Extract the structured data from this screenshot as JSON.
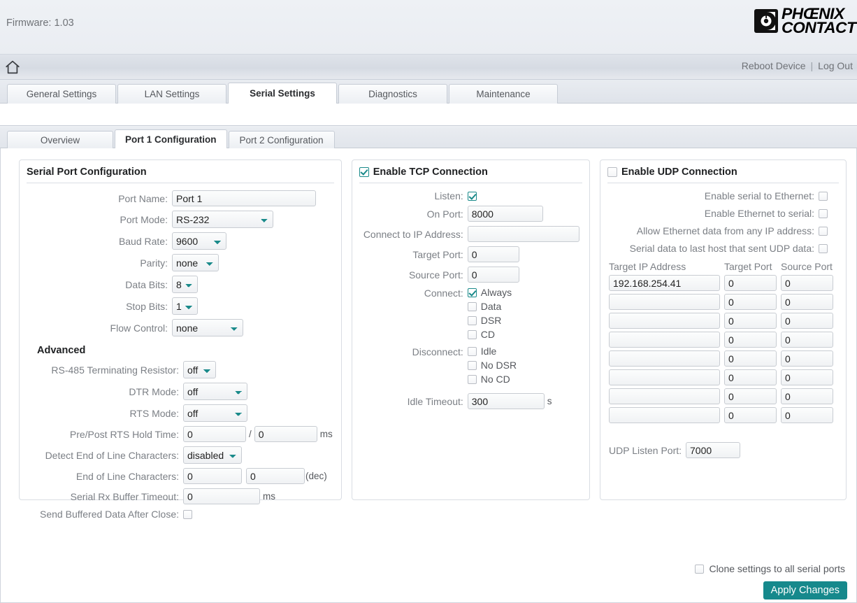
{
  "header": {
    "firmware": "Firmware: 1.03",
    "logo_line1": "PHŒNIX",
    "logo_line2": "CONTACT"
  },
  "nav": {
    "reboot": "Reboot Device",
    "separator": "|",
    "logout": "Log Out"
  },
  "tabs_primary": [
    {
      "label": "General Settings",
      "active": false
    },
    {
      "label": "LAN Settings",
      "active": false
    },
    {
      "label": "Serial Settings",
      "active": true
    },
    {
      "label": "Diagnostics",
      "active": false
    },
    {
      "label": "Maintenance",
      "active": false
    }
  ],
  "tabs_secondary": [
    {
      "label": "Overview",
      "active": false
    },
    {
      "label": "Port 1 Configuration",
      "active": true
    },
    {
      "label": "Port 2 Configuration",
      "active": false
    }
  ],
  "serial": {
    "title": "Serial Port Configuration",
    "advanced_title": "Advanced",
    "port_name_label": "Port Name:",
    "port_name_value": "Port 1",
    "port_mode_label": "Port Mode:",
    "port_mode_value": "RS-232",
    "baud_rate_label": "Baud Rate:",
    "baud_rate_value": "9600",
    "parity_label": "Parity:",
    "parity_value": "none",
    "data_bits_label": "Data Bits:",
    "data_bits_value": "8",
    "stop_bits_label": "Stop Bits:",
    "stop_bits_value": "1",
    "flow_control_label": "Flow Control:",
    "flow_control_value": "none",
    "rs485_label": "RS-485 Terminating Resistor:",
    "rs485_value": "off",
    "dtr_label": "DTR Mode:",
    "dtr_value": "off",
    "rts_label": "RTS Mode:",
    "rts_value": "off",
    "rts_hold_label": "Pre/Post RTS Hold Time:",
    "rts_hold_pre": "0",
    "rts_hold_sep": "/",
    "rts_hold_post": "0",
    "rts_hold_unit": "ms",
    "detect_eol_label": "Detect End of Line Characters:",
    "detect_eol_value": "disabled",
    "eol_chars_label": "End of Line Characters:",
    "eol_char1": "0",
    "eol_char2": "0",
    "eol_unit": "(dec)",
    "rx_timeout_label": "Serial Rx Buffer Timeout:",
    "rx_timeout_value": "0",
    "rx_timeout_unit": "ms",
    "send_buffered_label": "Send Buffered Data After Close:",
    "send_buffered_checked": false
  },
  "tcp": {
    "title": "Enable TCP Connection",
    "enabled": true,
    "listen_label": "Listen:",
    "listen_checked": true,
    "on_port_label": "On Port:",
    "on_port_value": "8000",
    "connect_ip_label": "Connect to IP Address:",
    "connect_ip_value": "",
    "target_port_label": "Target Port:",
    "target_port_value": "0",
    "source_port_label": "Source Port:",
    "source_port_value": "0",
    "connect_label": "Connect:",
    "connect_options": [
      {
        "label": "Always",
        "checked": true
      },
      {
        "label": "Data",
        "checked": false
      },
      {
        "label": "DSR",
        "checked": false
      },
      {
        "label": "CD",
        "checked": false
      }
    ],
    "disconnect_label": "Disconnect:",
    "disconnect_options": [
      {
        "label": "Idle",
        "checked": false
      },
      {
        "label": "No DSR",
        "checked": false
      },
      {
        "label": "No CD",
        "checked": false
      }
    ],
    "idle_timeout_label": "Idle Timeout:",
    "idle_timeout_value": "300",
    "idle_timeout_unit": "s"
  },
  "udp": {
    "title": "Enable UDP Connection",
    "enabled": false,
    "options": [
      {
        "label": "Enable serial to Ethernet:",
        "checked": false
      },
      {
        "label": "Enable Ethernet to serial:",
        "checked": false
      },
      {
        "label": "Allow Ethernet data from any IP address:",
        "checked": false
      },
      {
        "label": "Serial data to last host that sent UDP data:",
        "checked": false
      }
    ],
    "col_target_ip": "Target IP Address",
    "col_target_port": "Target Port",
    "col_source_port": "Source Port",
    "rows": [
      {
        "ip": "192.168.254.41",
        "target_port": "0",
        "source_port": "0"
      },
      {
        "ip": "",
        "target_port": "0",
        "source_port": "0"
      },
      {
        "ip": "",
        "target_port": "0",
        "source_port": "0"
      },
      {
        "ip": "",
        "target_port": "0",
        "source_port": "0"
      },
      {
        "ip": "",
        "target_port": "0",
        "source_port": "0"
      },
      {
        "ip": "",
        "target_port": "0",
        "source_port": "0"
      },
      {
        "ip": "",
        "target_port": "0",
        "source_port": "0"
      },
      {
        "ip": "",
        "target_port": "0",
        "source_port": "0"
      }
    ],
    "listen_port_label": "UDP Listen Port:",
    "listen_port_value": "7000"
  },
  "footer": {
    "clone_label": "Clone settings to all serial ports",
    "clone_checked": false,
    "apply_label": "Apply Changes"
  },
  "colors": {
    "accent_teal": "#16898c",
    "label_gray": "#7b7f85",
    "header_bg": "#eef1f5"
  }
}
